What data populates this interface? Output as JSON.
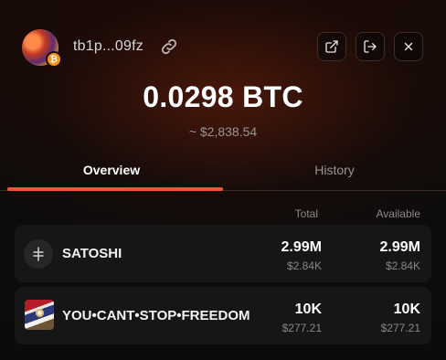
{
  "header": {
    "address": "tb1p...09fz",
    "icons": {
      "link": "link-icon",
      "external": "external-link-icon",
      "logout": "logout-icon",
      "close": "close-icon"
    }
  },
  "balance": {
    "amount": "0.0298 BTC",
    "usd": "~ $2,838.54"
  },
  "tabs": [
    {
      "label": "Overview",
      "active": true
    },
    {
      "label": "History",
      "active": false
    }
  ],
  "columns": {
    "total": "Total",
    "available": "Available"
  },
  "tokens": [
    {
      "name": "SATOSHI",
      "icon": "rune-icon",
      "total": "2.99M",
      "total_usd": "$2.84K",
      "available": "2.99M",
      "available_usd": "$2.84K"
    },
    {
      "name": "YOU•CANT•STOP•FREEDOM",
      "icon": "inscription-thumbnail",
      "total": "10K",
      "total_usd": "$277.21",
      "available": "10K",
      "available_usd": "$277.21"
    }
  ],
  "colors": {
    "accent": "#f2542d",
    "background": "#0b0b0b",
    "row": "#161616",
    "muted": "#8c8887"
  }
}
